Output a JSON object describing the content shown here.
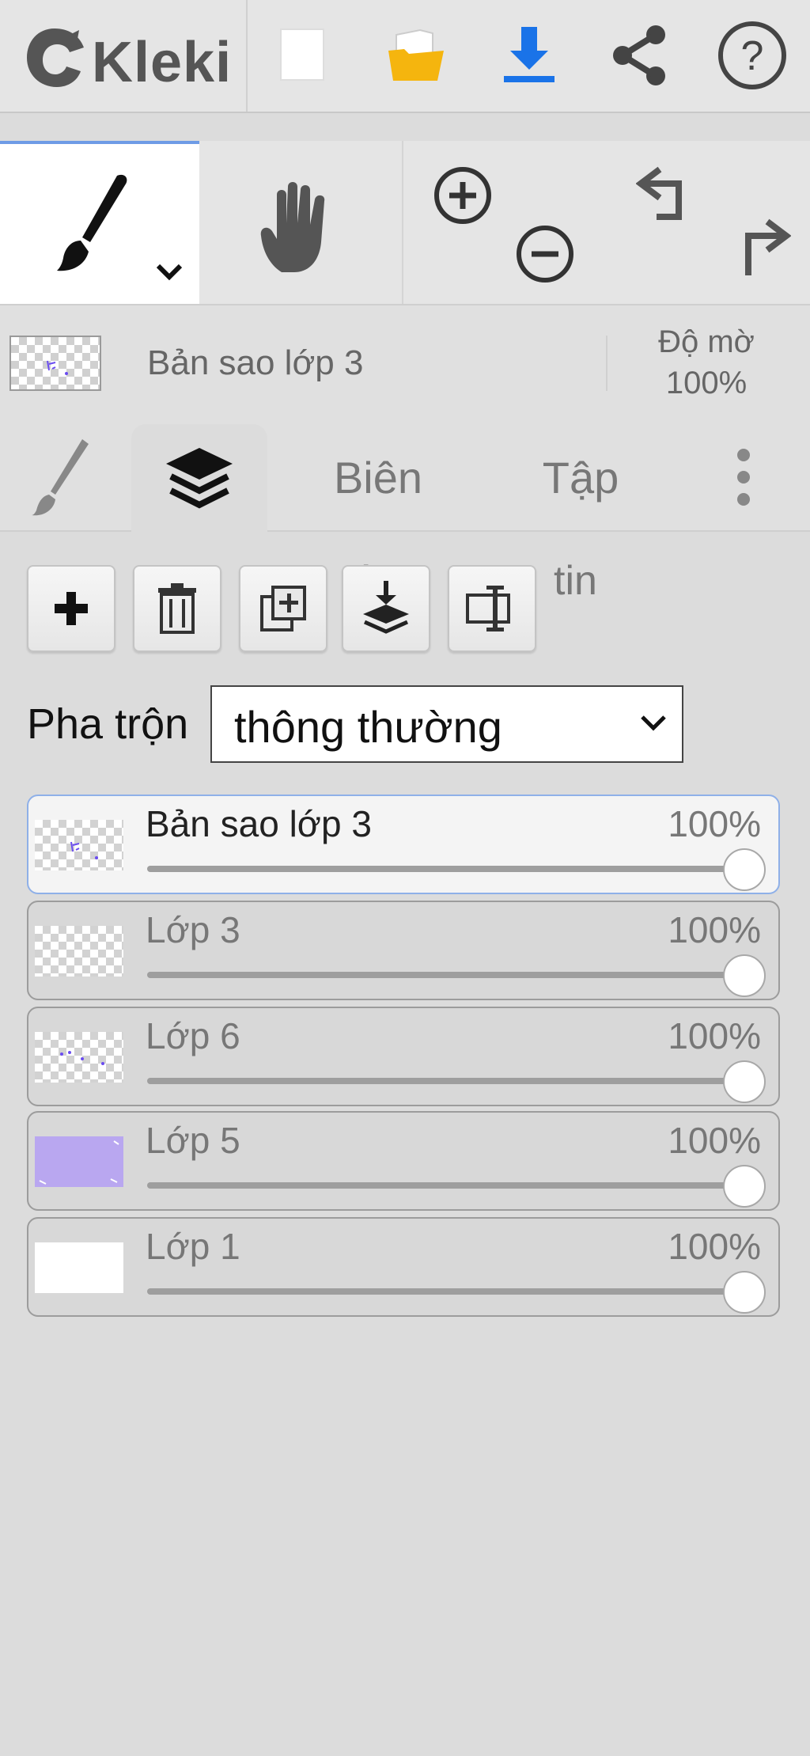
{
  "app": {
    "logo_text": "Kleki"
  },
  "header": {
    "icons": [
      "new-file-icon",
      "open-folder-icon",
      "download-icon",
      "share-icon",
      "help-icon"
    ],
    "colors": {
      "folder": "#f5b50e",
      "download": "#1a73e8"
    }
  },
  "tools": {
    "active": "brush",
    "items": [
      "brush-icon",
      "hand-icon",
      "zoom-in-icon",
      "zoom-out-icon",
      "undo-icon",
      "redo-icon"
    ]
  },
  "current_layer": {
    "name": "Bản sao lớp 3",
    "opacity_label": "Độ mờ",
    "opacity_value": "100%"
  },
  "tabs": {
    "items": [
      {
        "id": "brush",
        "label": ""
      },
      {
        "id": "layers",
        "label": ""
      },
      {
        "id": "edit",
        "label": "Biên"
      },
      {
        "id": "file",
        "label": "Tập"
      }
    ],
    "active": "layers",
    "overflow_edit": "tập",
    "overflow_file": "tin"
  },
  "layer_actions": [
    "add-layer-icon",
    "delete-layer-icon",
    "duplicate-layer-icon",
    "merge-down-icon",
    "rename-layer-icon"
  ],
  "blend": {
    "label": "Pha trộn",
    "value": "thông thường"
  },
  "layers": [
    {
      "name": "Bản sao lớp 3",
      "opacity": "100%",
      "opacity_fraction": 1.0,
      "active": true,
      "thumb": "purple-marks"
    },
    {
      "name": "Lớp 3",
      "opacity": "100%",
      "opacity_fraction": 1.0,
      "active": false,
      "thumb": "transparent"
    },
    {
      "name": "Lớp 6",
      "opacity": "100%",
      "opacity_fraction": 1.0,
      "active": false,
      "thumb": "purple-dots"
    },
    {
      "name": "Lớp 5",
      "opacity": "100%",
      "opacity_fraction": 1.0,
      "active": false,
      "thumb": "lavender-fill"
    },
    {
      "name": "Lớp 1",
      "opacity": "100%",
      "opacity_fraction": 1.0,
      "active": false,
      "thumb": "white-fill"
    }
  ],
  "colors": {
    "accent": "#6e9be6",
    "lavender": "#b9a7f0"
  }
}
